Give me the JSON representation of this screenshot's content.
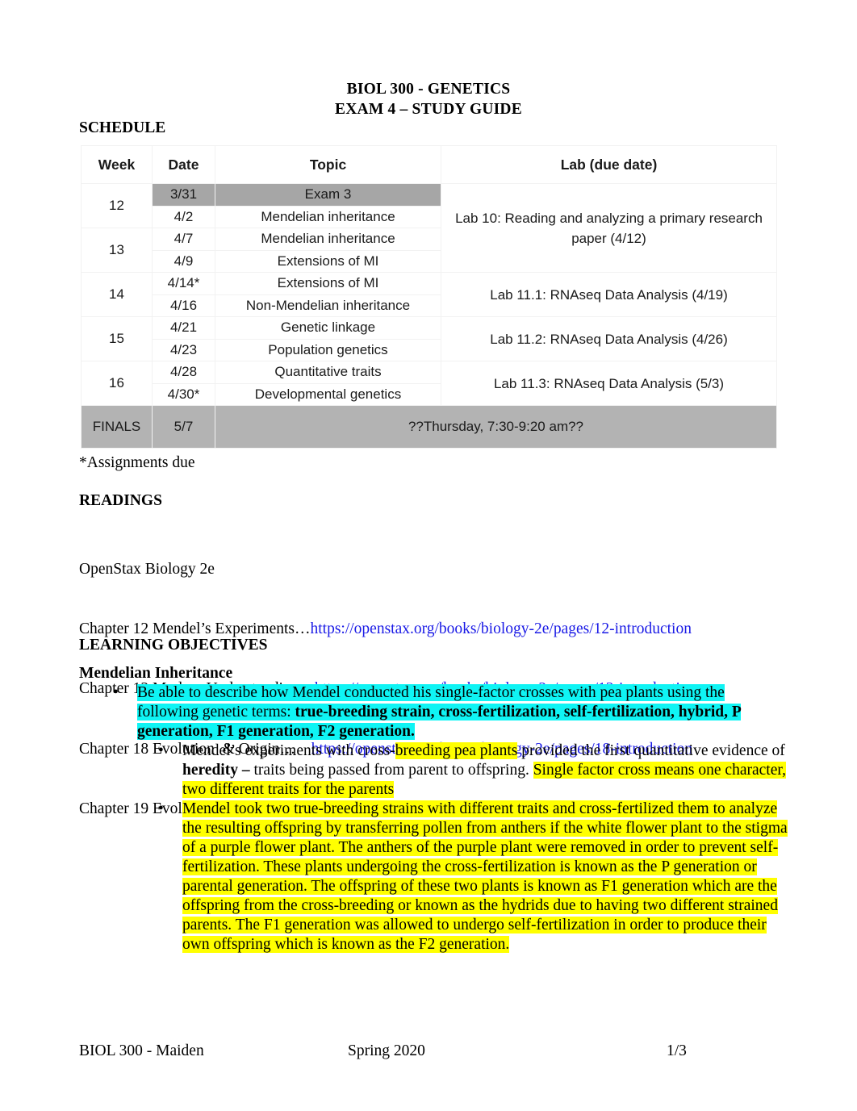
{
  "document": {
    "title_line1": "BIOL 300 - GENETICS",
    "title_line2": "EXAM 4 – STUDY GUIDE"
  },
  "schedule": {
    "heading": "SCHEDULE",
    "columns": [
      "Week",
      "Date",
      "Topic",
      "Lab (due date)"
    ],
    "rows": [
      {
        "week": "12",
        "dates": [
          "3/31",
          "4/2"
        ],
        "topics": [
          "Exam 3",
          "Mendelian inheritance"
        ],
        "exam_row": true
      },
      {
        "week": "13",
        "dates": [
          "4/7",
          "4/9"
        ],
        "topics": [
          "Mendelian inheritance",
          "Extensions of MI"
        ],
        "exam_row": false
      },
      {
        "week": "14",
        "dates": [
          "4/14*",
          "4/16"
        ],
        "topics": [
          "Extensions of MI",
          "Non-Mendelian inheritance"
        ],
        "exam_row": false
      },
      {
        "week": "15",
        "dates": [
          "4/21",
          "4/23"
        ],
        "topics": [
          "Genetic linkage",
          "Population genetics"
        ],
        "exam_row": false
      },
      {
        "week": "16",
        "dates": [
          "4/28",
          "4/30*"
        ],
        "topics": [
          "Quantitative traits",
          "Developmental genetics"
        ],
        "exam_row": false
      }
    ],
    "labs": [
      "Lab 10: Reading and analyzing a primary research paper (4/12)",
      "Lab 11.1: RNAseq Data Analysis (4/19)",
      "Lab 11.2: RNAseq Data Analysis (4/26)",
      "Lab 11.3: RNAseq Data Analysis (5/3)"
    ],
    "finals": {
      "week": "FINALS",
      "date": "5/7",
      "note": "??Thursday, 7:30-9:20 am??"
    },
    "footnote": "*Assignments due",
    "exam_row_shade": "#a6a6a6",
    "finals_row_shade": "#b3b3b3"
  },
  "readings": {
    "heading": "READINGS",
    "source": "OpenStax Biology 2e",
    "items": [
      {
        "label": "Chapter 12 Mendel’s Experiments…",
        "url": "https://openstax.org/books/biology-2e/pages/12-introduction",
        "gap": ""
      },
      {
        "label": "Chapter 13 Modern Understanding...",
        "url": "https://openstax.org/books/biology-2e/pages/13-introduction",
        "gap": " "
      },
      {
        "label": "Chapter 18 Evolution  & Origin…",
        "url": "https://openstax.org/books/biology-2e/pages/18-introduction",
        "gap": "    "
      },
      {
        "label": "Chapter 19 Evolution of Populations",
        "url": "https://openstax.org/books/biology-2e/pages/19-introduction",
        "gap": " "
      }
    ],
    "link_color": "#1a1ae6"
  },
  "objectives": {
    "heading": "LEARNING OBJECTIVES",
    "subheading": "Mendelian Inheritance",
    "highlight_cyan": "#0ff4f4",
    "highlight_yellow": "#ffff00",
    "bullet_glyph": "•",
    "b1_plain": "Be able to describe how Mendel conducted his single-factor crosses with pea plants using the following genetic terms: ",
    "b1_bold": "true-breeding strain, cross-fertilization, self-fertilization, hybrid, P generation, F1 generation, F2 generation.",
    "b2_1_a": "Mendel’s experiments with cross-",
    "b2_1_b": "breeding pea plants",
    "b2_1_c": " provided the first quantitative evidence of ",
    "b2_1_d": "heredity –",
    "b2_1_e": " traits being passed from parent to offspring. ",
    "b2_1_f": "Single factor cross means one character, two different traits for the parents",
    "b2_2": "Mendel took two true-breeding strains with different traits and cross-fertilized them to analyze the resulting offspring by transferring pollen from anthers if the white flower plant to the stigma of a purple flower plant. The anthers of the purple plant were removed in order to prevent self-fertilization. These plants undergoing the cross-fertilization is known as the P generation or parental generation. The offspring of these two plants is known as F1 generation which are the offspring from the cross-breeding or known as the hydrids due to having two different strained parents. The F1 generation was allowed to undergo self-fertilization in order to produce their own offspring which is known as the F2 generation."
  },
  "footer": {
    "left": "BIOL 300 - Maiden",
    "middle": "Spring 2020",
    "right": "1/3"
  }
}
